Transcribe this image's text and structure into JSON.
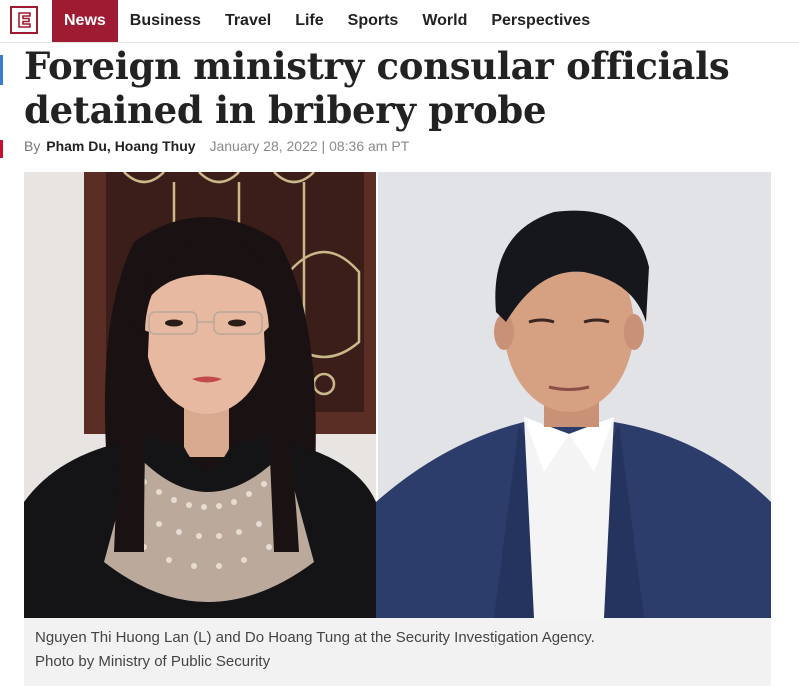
{
  "nav": {
    "logo_letter": "E",
    "items": [
      {
        "label": "News",
        "active": true
      },
      {
        "label": "Business",
        "active": false
      },
      {
        "label": "Travel",
        "active": false
      },
      {
        "label": "Life",
        "active": false
      },
      {
        "label": "Sports",
        "active": false
      },
      {
        "label": "World",
        "active": false
      },
      {
        "label": "Perspectives",
        "active": false
      }
    ]
  },
  "article": {
    "headline_line1": "Foreign ministry consular officials",
    "headline_line2": "detained in bribery probe",
    "byline_prefix": "By",
    "authors": "Pham Du, Hoang Thuy",
    "date": "January 28, 2022 | 08:36 am PT"
  },
  "photo": {
    "caption_line1": "Nguyen Thi Huong Lan (L) and Do Hoang Tung at the Security Investigation Agency.",
    "caption_line2": "Photo by Ministry of Public Security"
  },
  "colors": {
    "brand": "#9e1b32",
    "text": "#222222",
    "muted": "#777777",
    "caption_bg": "#f2f2f2"
  }
}
